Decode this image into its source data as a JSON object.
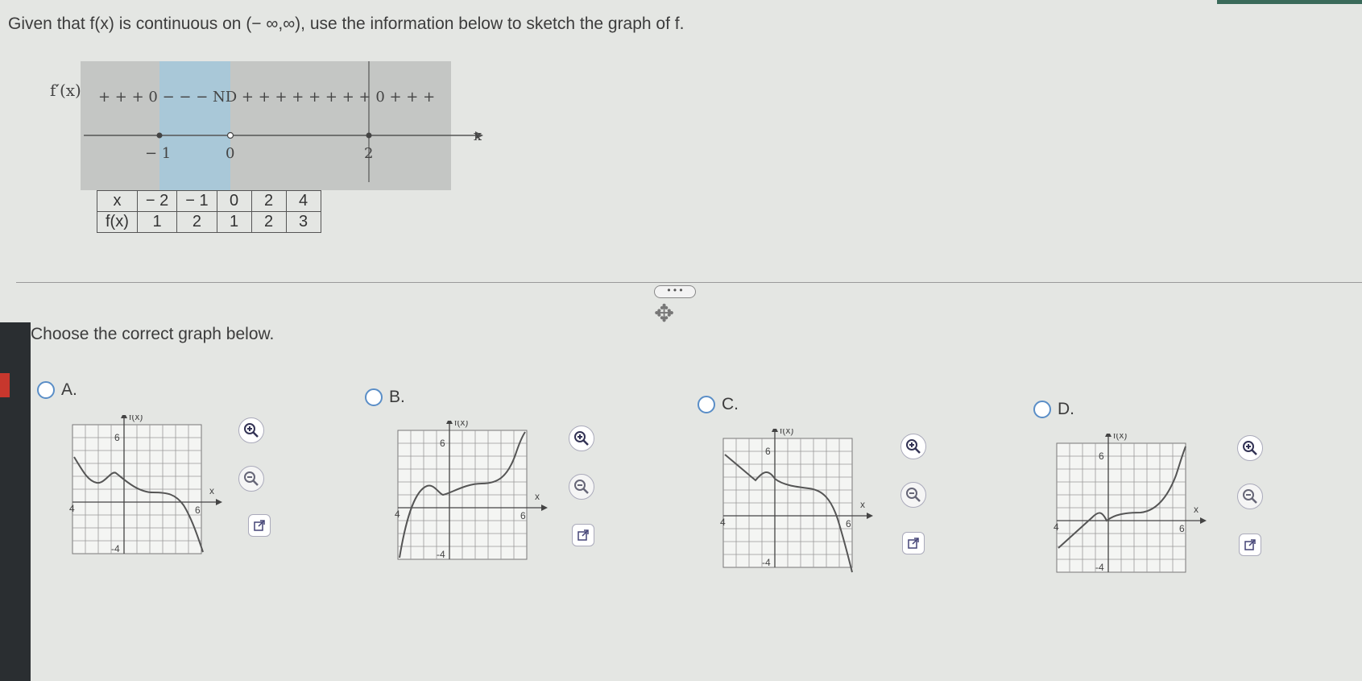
{
  "question": {
    "text": "Given that f(x) is continuous on (− ∞,∞), use the information below to sketch the graph of f."
  },
  "sign_chart": {
    "label": "f′(x)",
    "signs": "+ + + 0 − − − ND + + + + + + + + 0 + + +",
    "axis_label": "x",
    "ticks": [
      "− 1",
      "0",
      "2"
    ]
  },
  "table": {
    "x_header": "x",
    "fx_header": "f(x)",
    "x_values": [
      "− 2",
      "− 1",
      "0",
      "2",
      "4"
    ],
    "fx_values": [
      "1",
      "2",
      "1",
      "2",
      "3"
    ]
  },
  "more_button": {
    "label": "• • •"
  },
  "instruction": {
    "text": "Choose the correct graph below."
  },
  "options": [
    {
      "letter": "A.",
      "fx_label": "f(x)",
      "x_label": "x",
      "tick_top": "6",
      "tick_left": "-4",
      "tick_right": "6",
      "tick_bottom": "-4"
    },
    {
      "letter": "B.",
      "fx_label": "f(x)",
      "x_label": "x",
      "tick_top": "6",
      "tick_left": "-4",
      "tick_right": "6",
      "tick_bottom": "-4"
    },
    {
      "letter": "C.",
      "fx_label": "f(x)",
      "x_label": "x",
      "tick_top": "6",
      "tick_left": "-4",
      "tick_right": "6",
      "tick_bottom": "-4"
    },
    {
      "letter": "D.",
      "fx_label": "f(x)",
      "x_label": "x",
      "tick_top": "6",
      "tick_left": "-4",
      "tick_right": "6",
      "tick_bottom": "-4"
    }
  ],
  "colors": {
    "radio": "#5a8ec7",
    "shade_blue": "#a9c8d8",
    "shade_gray": "#c4c6c4",
    "curve": "#555555"
  },
  "icons": {
    "zoom_in": "zoom-in-icon",
    "zoom_out": "zoom-out-icon",
    "external": "external-link-icon",
    "move": "move-icon"
  }
}
